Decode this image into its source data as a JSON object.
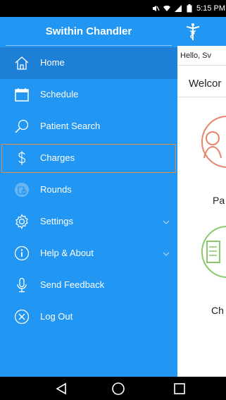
{
  "status_bar": {
    "time": "5:15 PM",
    "icons": [
      "mute-icon",
      "wifi-icon",
      "signal-icon",
      "battery-icon"
    ]
  },
  "drawer": {
    "title": "Swithin Chandler",
    "items": [
      {
        "label": "Home",
        "icon": "home-icon"
      },
      {
        "label": "Schedule",
        "icon": "calendar-icon"
      },
      {
        "label": "Patient Search",
        "icon": "search-icon"
      },
      {
        "label": "Charges",
        "icon": "dollar-icon"
      },
      {
        "label": "Rounds",
        "icon": "rounds-icon"
      },
      {
        "label": "Settings",
        "icon": "gear-icon"
      },
      {
        "label": "Help & About",
        "icon": "info-icon"
      },
      {
        "label": "Send Feedback",
        "icon": "microphone-icon"
      },
      {
        "label": "Log Out",
        "icon": "close-circle-icon"
      }
    ]
  },
  "main": {
    "greeting": "Hello, Sv",
    "welcome": "Welcor",
    "tiles": [
      {
        "label": "Pa"
      },
      {
        "label": "Ch"
      }
    ]
  },
  "colors": {
    "drawer_bg": "#2196F3",
    "active_item_bg": "#1E7FD6",
    "highlight_border": "#E58A3F",
    "tile1_border": "#E8836A",
    "tile2_border": "#8BC76B"
  }
}
